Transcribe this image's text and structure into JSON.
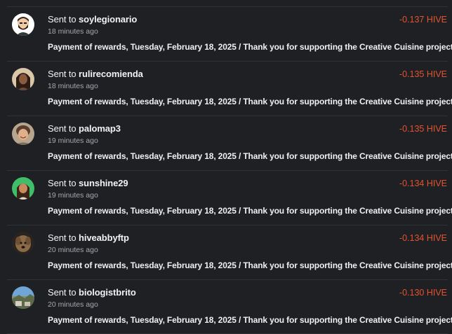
{
  "transfers": [
    {
      "prefix": "Sent to",
      "user": "soylegionario",
      "time": "18 minutes ago",
      "amount": "-0.137 HIVE",
      "memo": "Payment of rewards, Tuesday, February 18, 2025 / Thank you for supporting the Creative Cuisine project.",
      "avatar": "avatar-bearded-man-cartoon"
    },
    {
      "prefix": "Sent to",
      "user": "rulirecomienda",
      "time": "18 minutes ago",
      "amount": "-0.135 HIVE",
      "memo": "Payment of rewards, Tuesday, February 18, 2025 / Thank you for supporting the Creative Cuisine project.",
      "avatar": "avatar-woman-dark-hair"
    },
    {
      "prefix": "Sent to",
      "user": "palomap3",
      "time": "19 minutes ago",
      "amount": "-0.135 HIVE",
      "memo": "Payment of rewards, Tuesday, February 18, 2025 / Thank you for supporting the Creative Cuisine project.",
      "avatar": "avatar-woman-smiling"
    },
    {
      "prefix": "Sent to",
      "user": "sunshine29",
      "time": "19 minutes ago",
      "amount": "-0.134 HIVE",
      "memo": "Payment of rewards, Tuesday, February 18, 2025 / Thank you for supporting the Creative Cuisine project.",
      "avatar": "avatar-woman-green-background"
    },
    {
      "prefix": "Sent to",
      "user": "hiveabbyftp",
      "time": "20 minutes ago",
      "amount": "-0.134 HIVE",
      "memo": "Payment of rewards, Tuesday, February 18, 2025 / Thank you for supporting the Creative Cuisine project.",
      "avatar": "avatar-dog"
    },
    {
      "prefix": "Sent to",
      "user": "biologistbrito",
      "time": "20 minutes ago",
      "amount": "-0.130 HIVE",
      "memo": "Payment of rewards, Tuesday, February 18, 2025 / Thank you for supporting the Creative Cuisine project.",
      "avatar": "avatar-landscape"
    }
  ],
  "colors": {
    "background": "#1e2024",
    "divider": "#2e3136",
    "amount": "#e5532e",
    "primary_text": "#f2f2f2",
    "secondary_text": "#a5a8ad"
  }
}
